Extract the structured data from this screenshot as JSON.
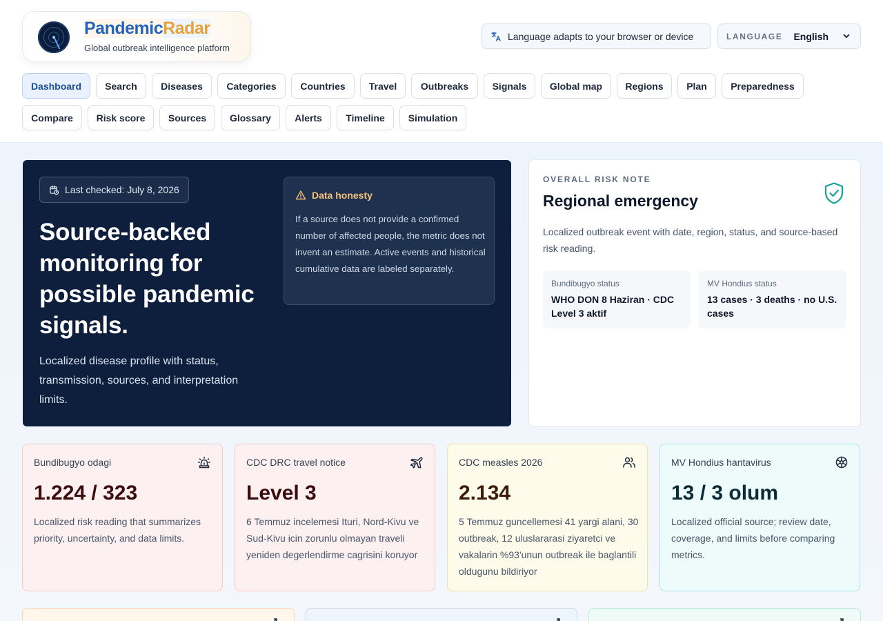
{
  "brand": {
    "name_part1": "Pandemic",
    "name_part2": "Radar",
    "tagline": "Global outbreak intelligence platform",
    "colors": {
      "primary": "#2563b8",
      "accent": "#e6a23c"
    }
  },
  "language": {
    "note": "Language adapts to your browser or device",
    "note_icon": "translate-icon",
    "label": "LANGUAGE",
    "selected": "English"
  },
  "nav": {
    "active": "Dashboard",
    "items": [
      "Dashboard",
      "Search",
      "Diseases",
      "Categories",
      "Countries",
      "Travel",
      "Outbreaks",
      "Signals",
      "Global map",
      "Regions",
      "Plan",
      "Preparedness",
      "Compare",
      "Risk score",
      "Sources",
      "Glossary",
      "Alerts",
      "Timeline",
      "Simulation"
    ]
  },
  "hero": {
    "last_checked": "Last checked: July 8, 2026",
    "title": "Source-backed monitoring for possible pandemic signals.",
    "subtitle": "Localized disease profile with status, transmission, sources, and interpretation limits.",
    "honesty_title": "Data honesty",
    "honesty_body": "If a source does not provide a confirmed number of affected people, the metric does not invent an estimate. Active events and historical cumulative data are labeled separately."
  },
  "risk_note": {
    "eyebrow": "OVERALL RISK NOTE",
    "title": "Regional emergency",
    "description": "Localized outbreak event with date, region, status, and source-based risk reading.",
    "items": [
      {
        "label": "Bundibugyo status",
        "value": "WHO DON 8 Haziran · CDC Level 3 aktif"
      },
      {
        "label": "MV Hondius status",
        "value": "13 cases · 3 deaths · no U.S. cases"
      }
    ]
  },
  "stats": [
    {
      "label": "Bundibugyo odagi",
      "value": "1.224 / 323",
      "text": "Localized risk reading that summarizes priority, uncertainty, and data limits.",
      "icon": "siren-icon",
      "tone": "#fdf0f0"
    },
    {
      "label": "CDC DRC travel notice",
      "value": "Level 3",
      "text": "6 Temmuz incelemesi Ituri, Nord-Kivu ve Sud-Kivu icin zorunlu olmayan traveli yeniden degerlendirme cagrisini koruyor",
      "icon": "plane-icon",
      "tone": "#fdf0f0"
    },
    {
      "label": "CDC measles 2026",
      "value": "2.134",
      "text": "5 Temmuz guncellemesi 41 yargi alani, 30 outbreak, 12 uluslararasi ziyaretci ve vakalarin %93'unun outbreak ile baglantili oldugunu bildiriyor",
      "icon": "users-icon",
      "tone": "#fefbea"
    },
    {
      "label": "MV Hondius hantavirus",
      "value": "13 / 3 olum",
      "text": "Localized official source; review date, coverage, and limits before comparing metrics.",
      "icon": "ship-wheel-icon",
      "tone": "#edfbfa"
    }
  ]
}
